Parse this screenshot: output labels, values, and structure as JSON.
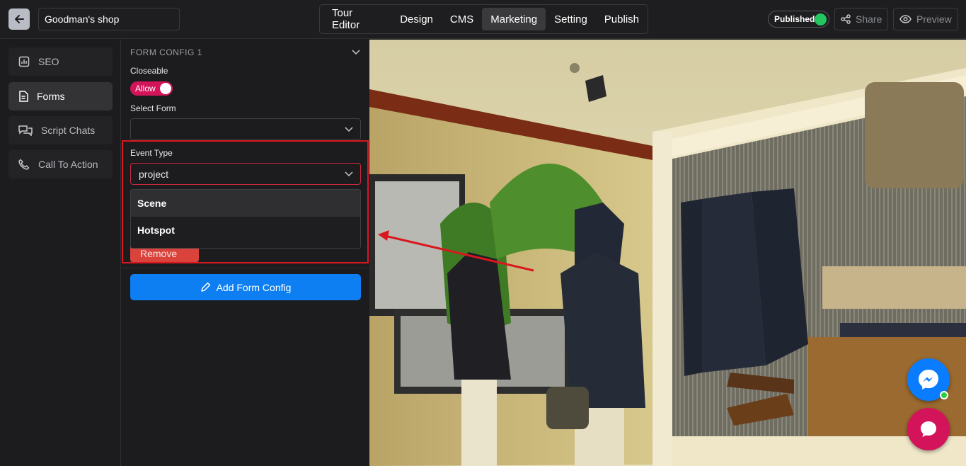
{
  "header": {
    "shop_name": "Goodman's shop",
    "nav": [
      "Tour Editor",
      "Design",
      "CMS",
      "Marketing",
      "Setting",
      "Publish"
    ],
    "active_nav": "Marketing",
    "status_label": "Published",
    "share_label": "Share",
    "preview_label": "Preview"
  },
  "sidebar": {
    "items": [
      {
        "label": "SEO",
        "icon": "chart-icon"
      },
      {
        "label": "Forms",
        "icon": "document-icon"
      },
      {
        "label": "Script Chats",
        "icon": "chat-bubbles-icon"
      },
      {
        "label": "Call To Action",
        "icon": "phone-icon"
      }
    ],
    "active": "Forms"
  },
  "form_config": {
    "title": "FORM CONFIG 1",
    "closeable_label": "Closeable",
    "closeable_toggle": "Allow",
    "select_form_label": "Select Form",
    "select_form_value": "",
    "event_type_label": "Event Type",
    "event_type_value": "project",
    "event_type_options": [
      "Scene",
      "Hotspot"
    ],
    "remove_label": "Remove",
    "add_label": "Add Form Config"
  },
  "colors": {
    "accent_blue": "#0d7ff2",
    "toggle_pink": "#d4145a",
    "highlight_red": "#d9171f",
    "published_green": "#22c55e"
  }
}
